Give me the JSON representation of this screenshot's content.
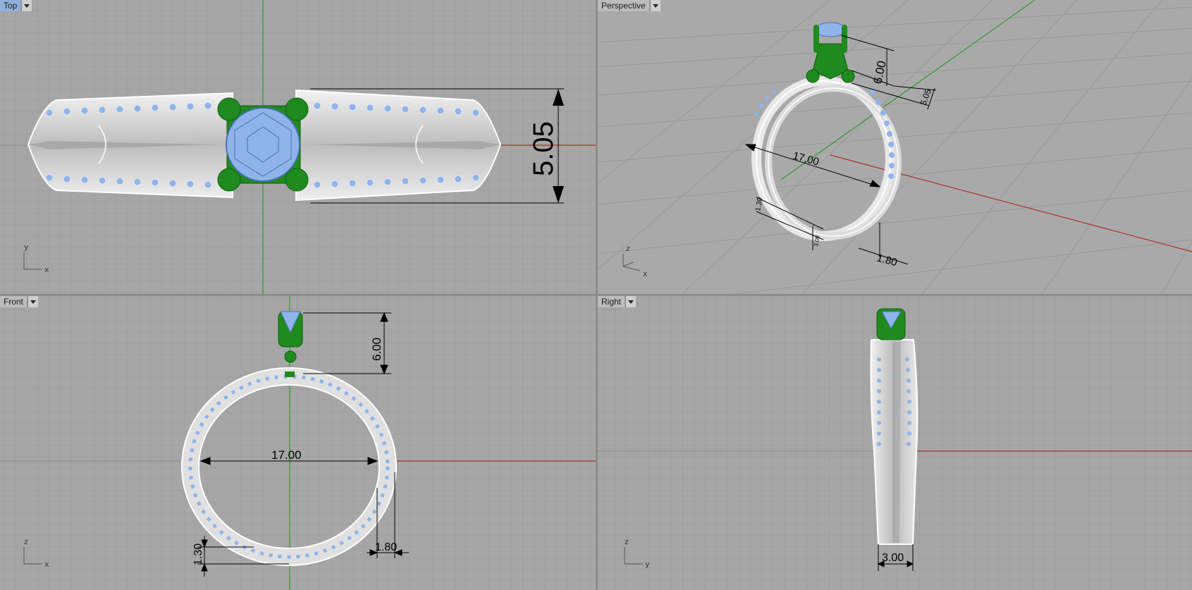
{
  "viewports": {
    "top": {
      "label": "Top",
      "axis_v": "y",
      "axis_h": "x",
      "dims": [
        "5.05"
      ]
    },
    "perspective": {
      "label": "Perspective",
      "axis_v": "z",
      "axis_h": "x",
      "dims": [
        "6.00",
        "5.05",
        "17.00",
        "1.30",
        "3.00",
        "1.80"
      ]
    },
    "front": {
      "label": "Front",
      "axis_v": "z",
      "axis_h": "x",
      "dims": [
        "6.00",
        "17.00",
        "1.30",
        "1.80"
      ]
    },
    "right": {
      "label": "Right",
      "axis_v": "z",
      "axis_h": "y",
      "dims": [
        "3.00"
      ]
    }
  },
  "colors": {
    "background": "#a6a6a6",
    "grid_minor": "#999999",
    "grid_major": "#8a8a8a",
    "x_axis": "#b03030",
    "y_axis": "#2e9a2e",
    "prongs": "#1f8a1f",
    "gem": "#8fb4ea",
    "metal": "#d9d9d9",
    "active_tab": "#8fb1dc"
  }
}
